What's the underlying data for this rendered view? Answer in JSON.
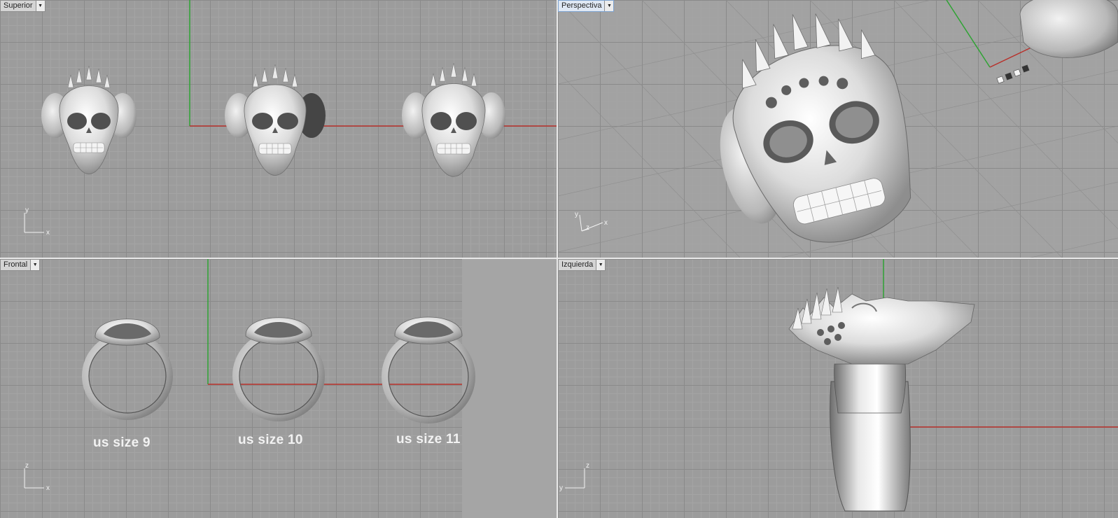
{
  "viewports": {
    "top": {
      "title": "Superior"
    },
    "perspective": {
      "title": "Perspectiva"
    },
    "front": {
      "title": "Frontal",
      "size_labels": [
        "us size 9",
        "us size 10",
        "us size 11"
      ]
    },
    "left": {
      "title": "Izquierda"
    }
  },
  "axes": {
    "x": "x",
    "y": "y",
    "z": "z"
  },
  "colors": {
    "viewport_bg": "#9c9c9c",
    "grid_major": "#8a8a8a",
    "x_axis": "#b8302a",
    "y_axis": "#2fa334",
    "active_tab": "#dfe8f4"
  },
  "icons": {
    "viewport_menu": "dropdown-arrow-icon"
  }
}
